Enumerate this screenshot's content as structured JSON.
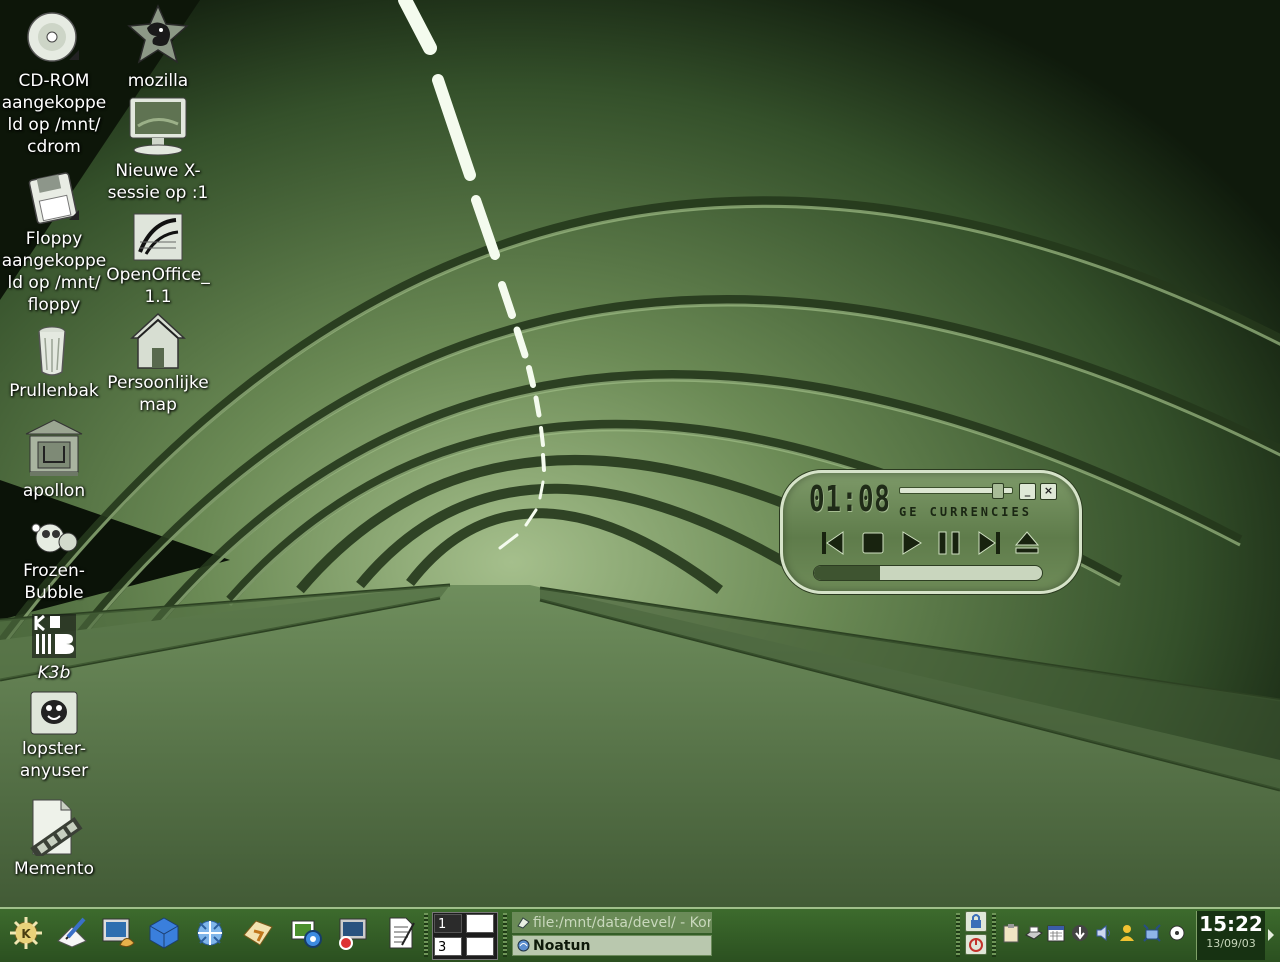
{
  "desktop": {
    "icons": [
      {
        "label": "CD-ROM\naangekoppe\nld op /mnt/\ncdrom",
        "icon": "cdrom-icon"
      },
      {
        "label": "Floppy\naangekoppe\nld op /mnt/\nfloppy",
        "icon": "floppy-icon"
      },
      {
        "label": "Prullenbak",
        "icon": "trash-icon"
      },
      {
        "label": "apollon",
        "icon": "network-share-icon"
      },
      {
        "label": "Frozen-\nBubble",
        "icon": "frozen-bubble-icon"
      },
      {
        "label": "K3b",
        "icon": "k3b-icon"
      },
      {
        "label": "lopster-\nanyuser",
        "icon": "lopster-icon"
      },
      {
        "label": "Memento",
        "icon": "memento-icon"
      },
      {
        "label": "mozilla",
        "icon": "mozilla-icon"
      },
      {
        "label": "Nieuwe X-\nsessie op :1",
        "icon": "monitor-icon"
      },
      {
        "label": "OpenOffice_\n1.1",
        "icon": "openoffice-icon"
      },
      {
        "label": "Persoonlijke\nmap",
        "icon": "home-folder-icon"
      }
    ]
  },
  "player": {
    "time": "01:08",
    "scroll_text": "GE CURRENCIES",
    "volume_fraction": 0.9,
    "progress_fraction": 0.29,
    "minimize_label": "_",
    "close_label": "×",
    "controls": [
      "previous-icon",
      "stop-icon",
      "play-icon",
      "pause-icon",
      "next-icon",
      "eject-icon"
    ]
  },
  "taskbar": {
    "launchers": [
      "kde-menu-icon",
      "kwrite-icon",
      "konsole-icon",
      "package-icon",
      "konqueror-icon",
      "file-manager-icon",
      "kcontrol-icon",
      "display-icon",
      "document-icon"
    ],
    "pager": {
      "desktop1": "1",
      "desktop3": "3"
    },
    "tasks": [
      {
        "label": "file:/mnt/data/devel/ - Kor",
        "icon": "konqueror-small-icon"
      },
      {
        "label": "Noatun",
        "icon": "noatun-small-icon"
      }
    ],
    "tray": [
      "klipper-icon",
      "printer-icon",
      "calendar-icon",
      "download-icon",
      "volume-icon",
      "user-icon",
      "network-icon",
      "cd-icon"
    ],
    "clock_time": "15:22",
    "clock_date": "13/09/03"
  },
  "colors": {
    "taskbar": "#2b5020",
    "player": "#6e8b58",
    "clock_bg": "#173212"
  }
}
